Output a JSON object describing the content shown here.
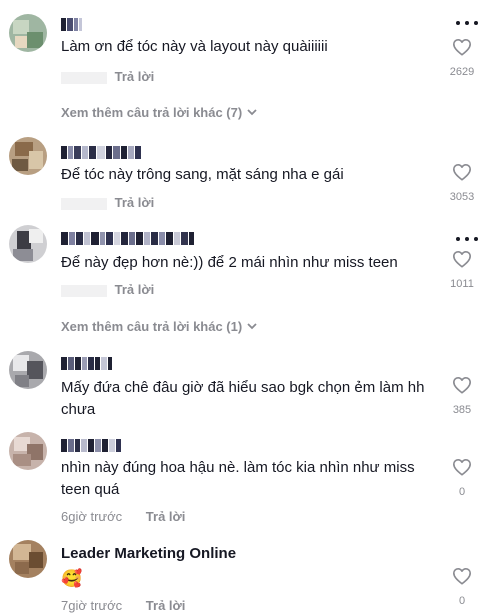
{
  "comments": [
    {
      "text": "Làm ơn để tóc này và layout này quàiiiiii",
      "reply": "Trả lời",
      "likes": "2629",
      "view_more": "Xem thêm câu trả lời khác (7)"
    },
    {
      "text": "Để tóc này trông sang, mặt sáng nha e gái",
      "reply": "Trả lời",
      "likes": "3053"
    },
    {
      "text": "Để này đẹp hơn nè:)) để 2 mái nhìn như miss teen",
      "reply": "Trả lời",
      "likes": "1011",
      "view_more": "Xem thêm câu trả lời khác (1)"
    },
    {
      "text": "Mấy đứa chê đâu giờ đã hiểu sao bgk chọn ẻm làm hh chưa",
      "likes": "385"
    },
    {
      "text": "nhìn này đúng hoa hậu nè. làm tóc kia nhìn như miss teen quá",
      "time": "6giờ trước",
      "reply": "Trả lời",
      "likes": "0"
    },
    {
      "name": "Leader Marketing Online",
      "text": "🥰",
      "time": "7giờ trước",
      "reply": "Trả lời",
      "likes": "0"
    }
  ],
  "colors": {
    "text": "#161823",
    "muted": "#8a8b91",
    "blur": "#f1f1f2"
  },
  "icons": {
    "like": "heart-outline-icon",
    "more": "more-dots-icon",
    "expand": "chevron-down-icon"
  }
}
